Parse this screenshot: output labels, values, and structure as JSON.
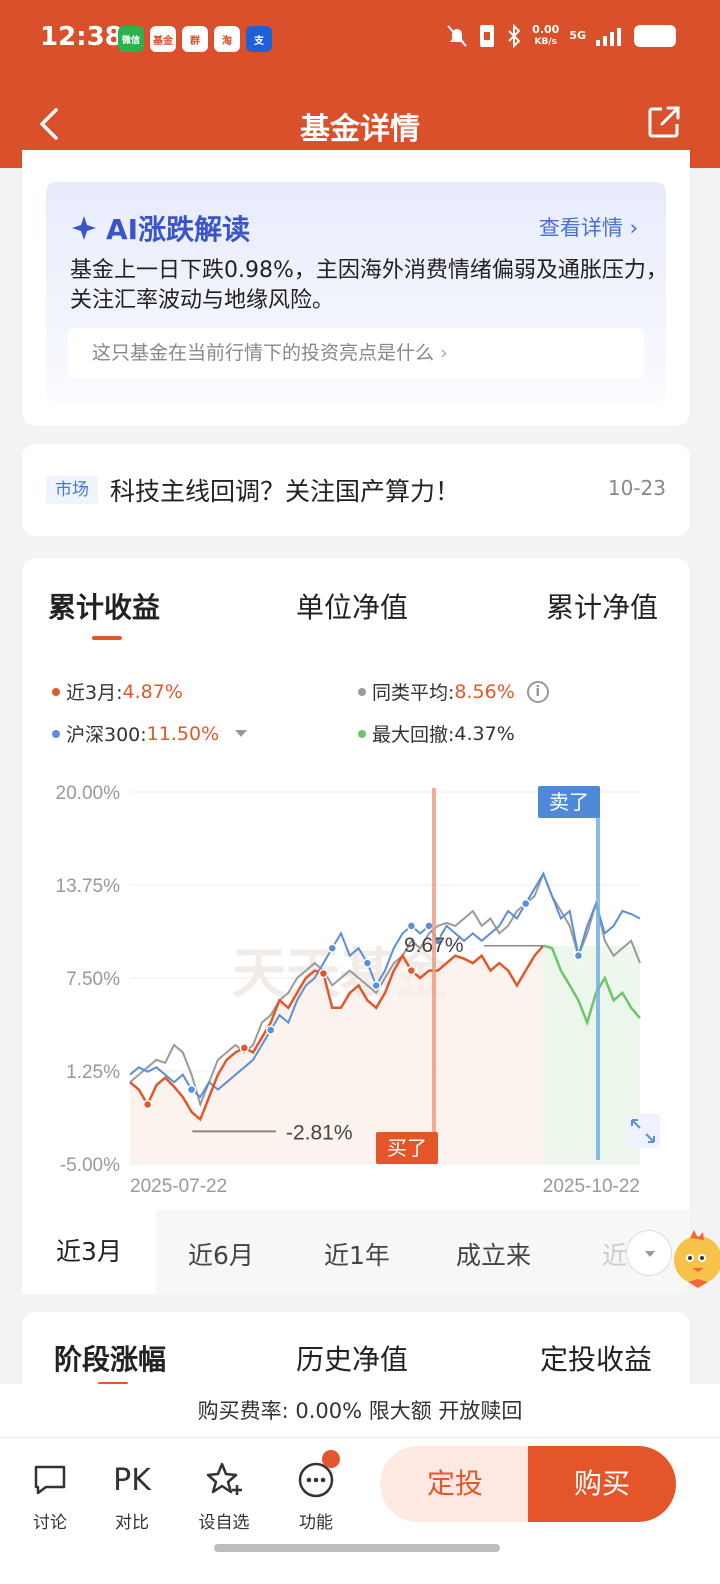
{
  "status": {
    "time": "12:38",
    "apps": [
      "微信",
      "基金",
      "群",
      "淘",
      "支"
    ],
    "net_speed": "0.00",
    "net_unit": "KB/s",
    "net_type": "5G"
  },
  "header": {
    "title": "基金详情"
  },
  "ai": {
    "title": "AI涨跌解读",
    "detail_link": "查看详情",
    "text": "基金上一日下跌0.98%，主因海外消费情绪偏弱及通胀压力，关注汇率波动与地缘风险。",
    "question": "这只基金在当前行情下的投资亮点是什么"
  },
  "news": {
    "tag": "市场",
    "title": "科技主线回调？关注国产算力！",
    "date": "10-23"
  },
  "chart_tabs": [
    "累计收益",
    "单位净值",
    "累计净值"
  ],
  "legend": {
    "fund_label": "近3月:",
    "fund_value": "4.87%",
    "peer_label": "同类平均:",
    "peer_value": "8.56%",
    "index_label": "沪深300:",
    "index_value": "11.50%",
    "drawdown_label": "最大回撤:",
    "drawdown_value": "4.37%"
  },
  "chart_data": {
    "type": "line",
    "ylim": [
      -5,
      20
    ],
    "yticks": [
      "20.00%",
      "13.75%",
      "7.50%",
      "1.25%",
      "-5.00%"
    ],
    "x_start_label": "2025-07-22",
    "x_end_label": "2025-10-22",
    "watermark": "天天基金",
    "annotations": {
      "min_label": "-2.81%",
      "peak_label": "9.67%",
      "buy_label": "买了",
      "sell_label": "卖了"
    },
    "series": [
      {
        "name": "近3月",
        "color": "#e2572c",
        "values": [
          0.5,
          0.0,
          -1.0,
          0.3,
          0.8,
          0.2,
          -0.5,
          -1.5,
          -2.0,
          -0.5,
          1.0,
          2.0,
          2.5,
          2.8,
          2.5,
          3.5,
          4.5,
          6.0,
          5.5,
          6.5,
          7.5,
          8.0,
          7.8,
          5.5,
          5.5,
          6.5,
          7.0,
          6.0,
          5.5,
          6.5,
          8.0,
          9.0,
          8.0,
          7.5,
          8.0,
          8.0,
          8.5,
          9.0,
          8.8,
          8.5,
          9.0,
          8.0,
          8.5,
          8.0,
          7.0,
          8.0,
          9.0,
          9.67,
          9.5,
          8.0,
          7.0,
          6.0,
          4.5,
          6.5,
          7.5,
          6.0,
          6.5,
          5.5,
          4.8
        ]
      },
      {
        "name": "同类平均",
        "color": "#9a9a9a",
        "values": [
          0.5,
          1.0,
          1.5,
          2.0,
          1.8,
          3.0,
          2.5,
          1.0,
          -1.0,
          0.5,
          2.0,
          2.5,
          3.0,
          2.5,
          3.0,
          4.5,
          5.0,
          6.0,
          6.5,
          7.5,
          8.0,
          8.5,
          8.0,
          7.0,
          7.5,
          8.0,
          7.5,
          7.0,
          6.5,
          7.5,
          8.5,
          9.0,
          10.0,
          9.5,
          10.5,
          11.0,
          11.2,
          11.0,
          11.5,
          12.0,
          11.0,
          11.5,
          10.5,
          11.0,
          12.0,
          12.5,
          13.0,
          14.5,
          13.0,
          12.0,
          11.0,
          9.0,
          10.5,
          12.5,
          10.0,
          9.0,
          9.5,
          10.0,
          8.5
        ]
      },
      {
        "name": "沪深300",
        "color": "#5b8fd8",
        "values": [
          1.0,
          1.5,
          1.2,
          1.5,
          1.0,
          0.5,
          1.0,
          0.0,
          -0.5,
          0.5,
          0.0,
          0.5,
          1.0,
          1.5,
          2.0,
          3.0,
          4.0,
          5.0,
          4.5,
          6.0,
          7.0,
          7.5,
          8.5,
          9.5,
          10.5,
          9.0,
          9.5,
          8.5,
          7.0,
          8.0,
          9.5,
          10.5,
          11.0,
          10.5,
          11.0,
          10.0,
          11.0,
          10.5,
          10.0,
          10.5,
          10.0,
          10.5,
          11.0,
          12.0,
          11.5,
          12.5,
          13.5,
          14.5,
          13.0,
          11.5,
          12.0,
          9.0,
          11.0,
          12.5,
          10.5,
          11.0,
          12.0,
          11.8,
          11.5
        ]
      }
    ],
    "drawdown_start_index": 47
  },
  "periods": [
    "近3月",
    "近6月",
    "近1年",
    "成立来",
    "近"
  ],
  "stage_tabs": [
    "阶段涨幅",
    "历史净值",
    "定投收益"
  ],
  "fee": "购买费率: 0.00% 限大额 开放赎回",
  "bottom_nav": [
    {
      "label": "讨论",
      "icon": "chat-icon"
    },
    {
      "label": "对比",
      "icon": "pk-icon",
      "glyph": "PK"
    },
    {
      "label": "设自选",
      "icon": "star-add-icon"
    },
    {
      "label": "功能",
      "icon": "more-icon"
    }
  ],
  "actions": {
    "auto_invest": "定投",
    "buy": "购买"
  }
}
